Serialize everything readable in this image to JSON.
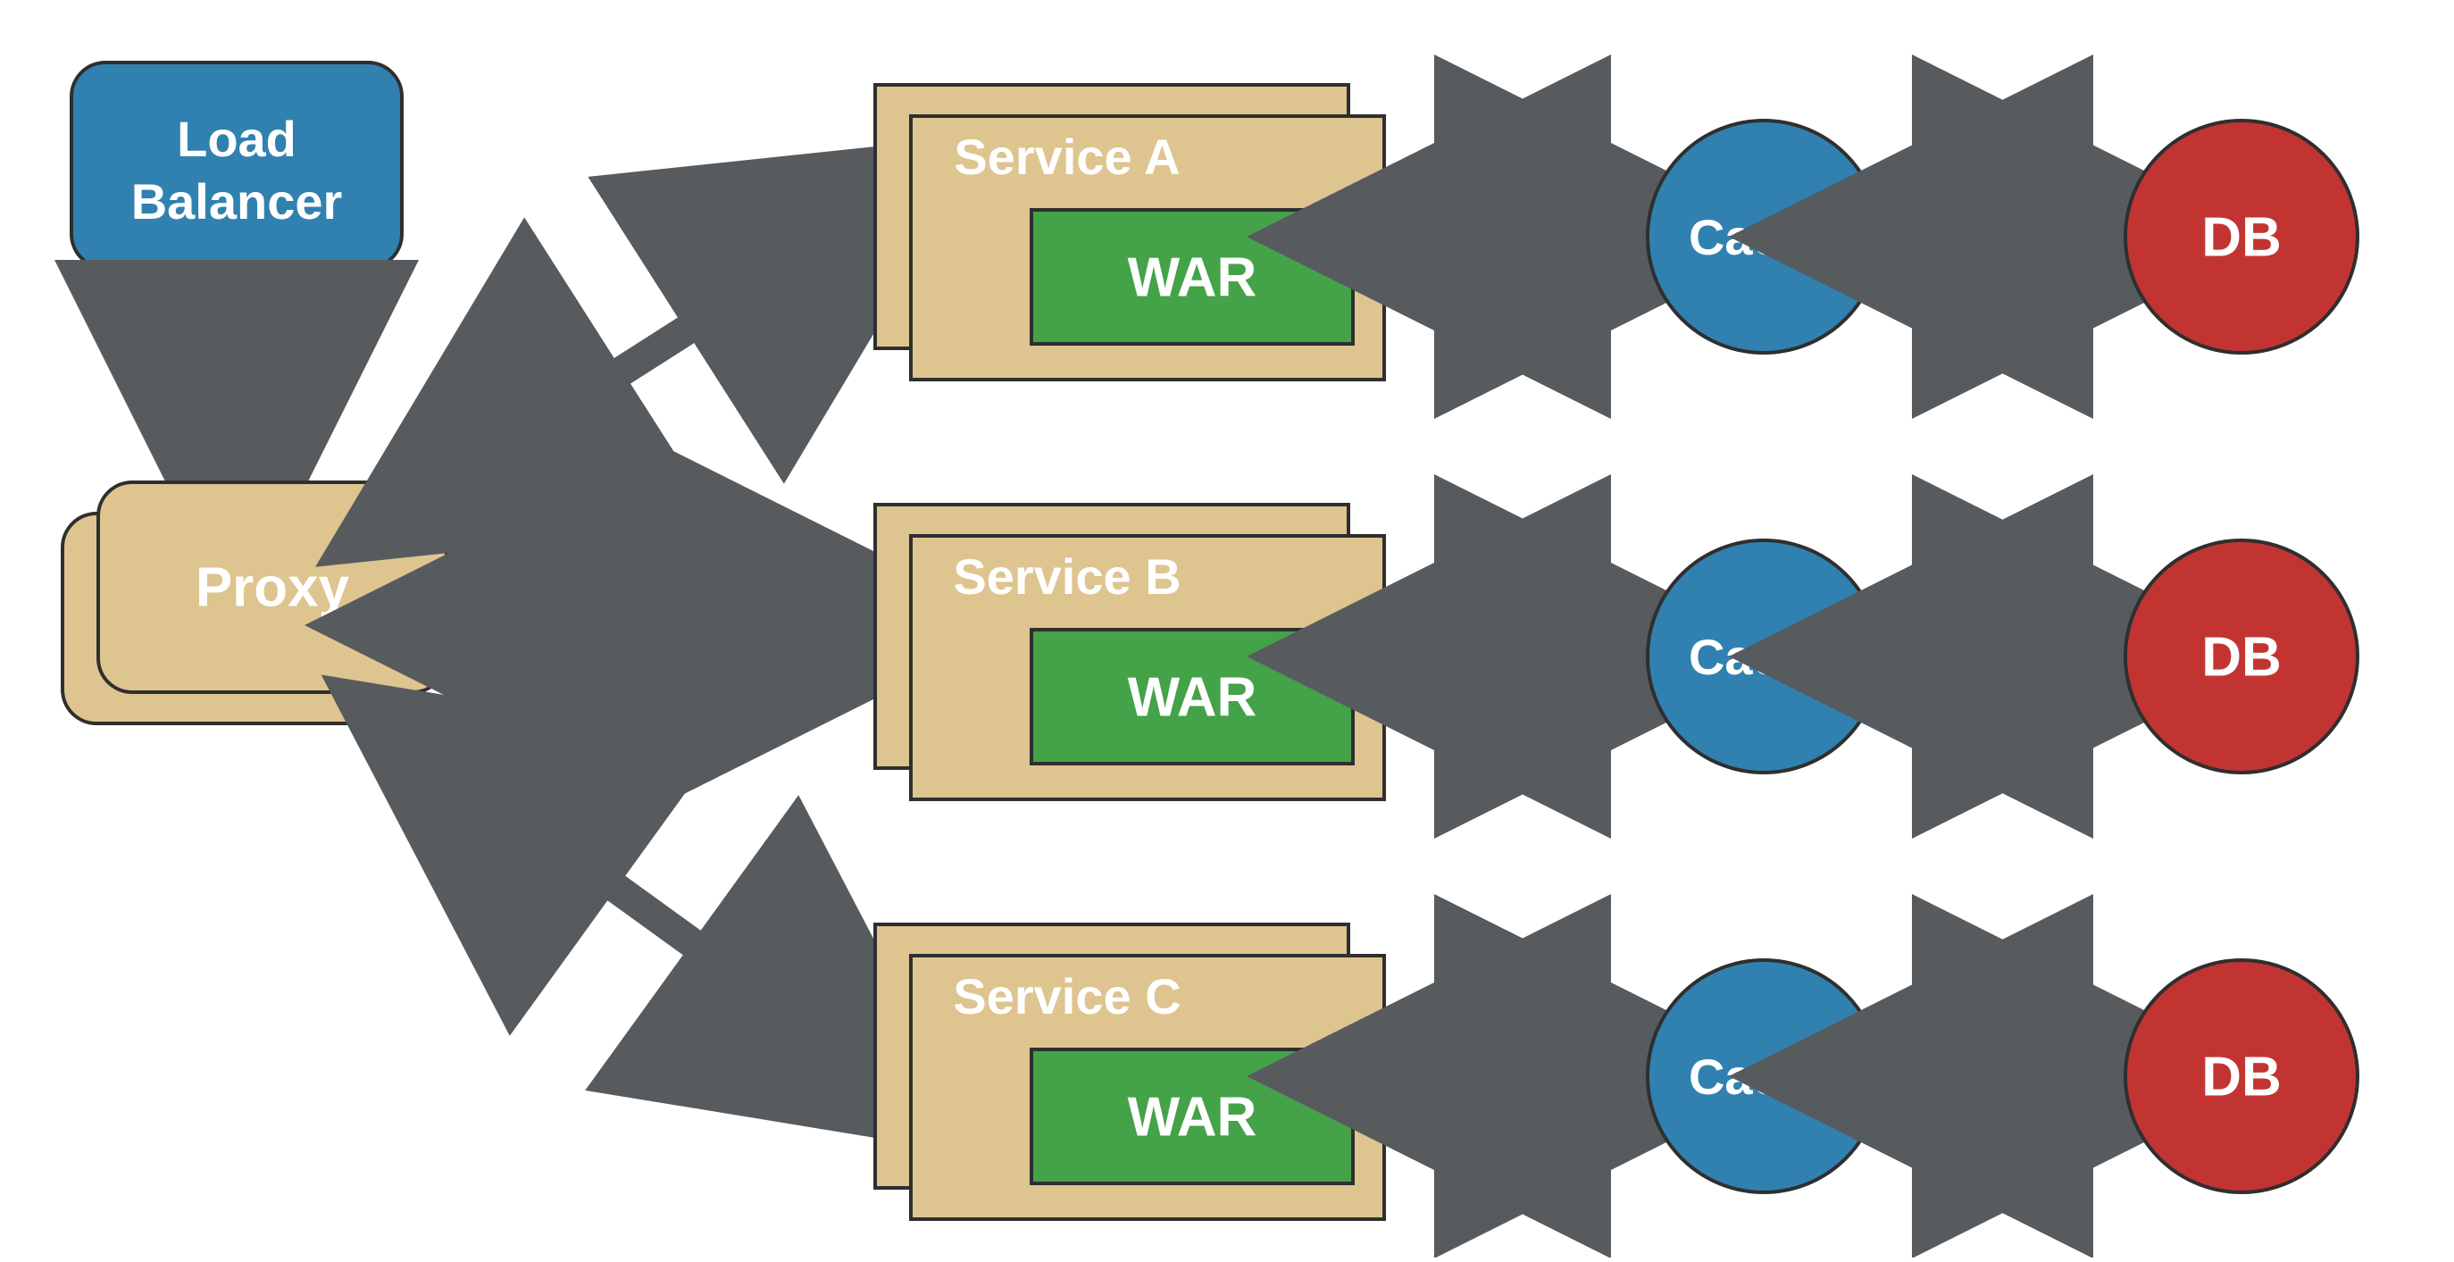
{
  "colors": {
    "blue": "#3081B0",
    "tan": "#DEC48F",
    "green": "#44A248",
    "red": "#C23432",
    "arrow": "#575B5E",
    "stroke": "#2F2F2F"
  },
  "nodes": {
    "load_balancer": {
      "line1": "Load",
      "line2": "Balancer"
    },
    "proxy": {
      "label": "Proxy"
    },
    "services": [
      {
        "label": "Service A",
        "war": "WAR",
        "cache": "Cache",
        "db": "DB"
      },
      {
        "label": "Service B",
        "war": "WAR",
        "cache": "Cache",
        "db": "DB"
      },
      {
        "label": "Service C",
        "war": "WAR",
        "cache": "Cache",
        "db": "DB"
      }
    ]
  },
  "layout_description": "Architecture: Load Balancer -> Proxy (stacked) <-> three Services (A/B/C each a stacked container with a WAR inside) <-> Cache <-> DB per row."
}
